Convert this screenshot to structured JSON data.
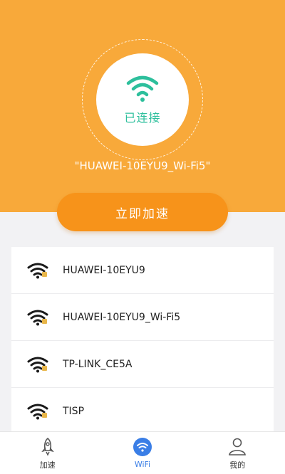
{
  "colors": {
    "hero_bg": "#f8a93a",
    "button_bg": "#f7931a",
    "connected_teal": "#2dbf9c",
    "active_tab": "#3a7ee6"
  },
  "status": {
    "icon": "wifi-icon",
    "text": "已连接",
    "ssid": "\"HUAWEI-10EYU9_Wi-Fi5\""
  },
  "accelerate_button": {
    "label": "立即加速"
  },
  "networks": [
    {
      "name": "HUAWEI-10EYU9",
      "icon": "wifi-locked-icon"
    },
    {
      "name": "HUAWEI-10EYU9_Wi-Fi5",
      "icon": "wifi-locked-icon"
    },
    {
      "name": "TP-LINK_CE5A",
      "icon": "wifi-locked-icon"
    },
    {
      "name": "TISP",
      "icon": "wifi-locked-icon"
    }
  ],
  "tabs": [
    {
      "label": "加速",
      "icon": "rocket-icon",
      "active": false
    },
    {
      "label": "WiFi",
      "icon": "wifi-icon",
      "active": true
    },
    {
      "label": "我的",
      "icon": "user-icon",
      "active": false
    }
  ]
}
